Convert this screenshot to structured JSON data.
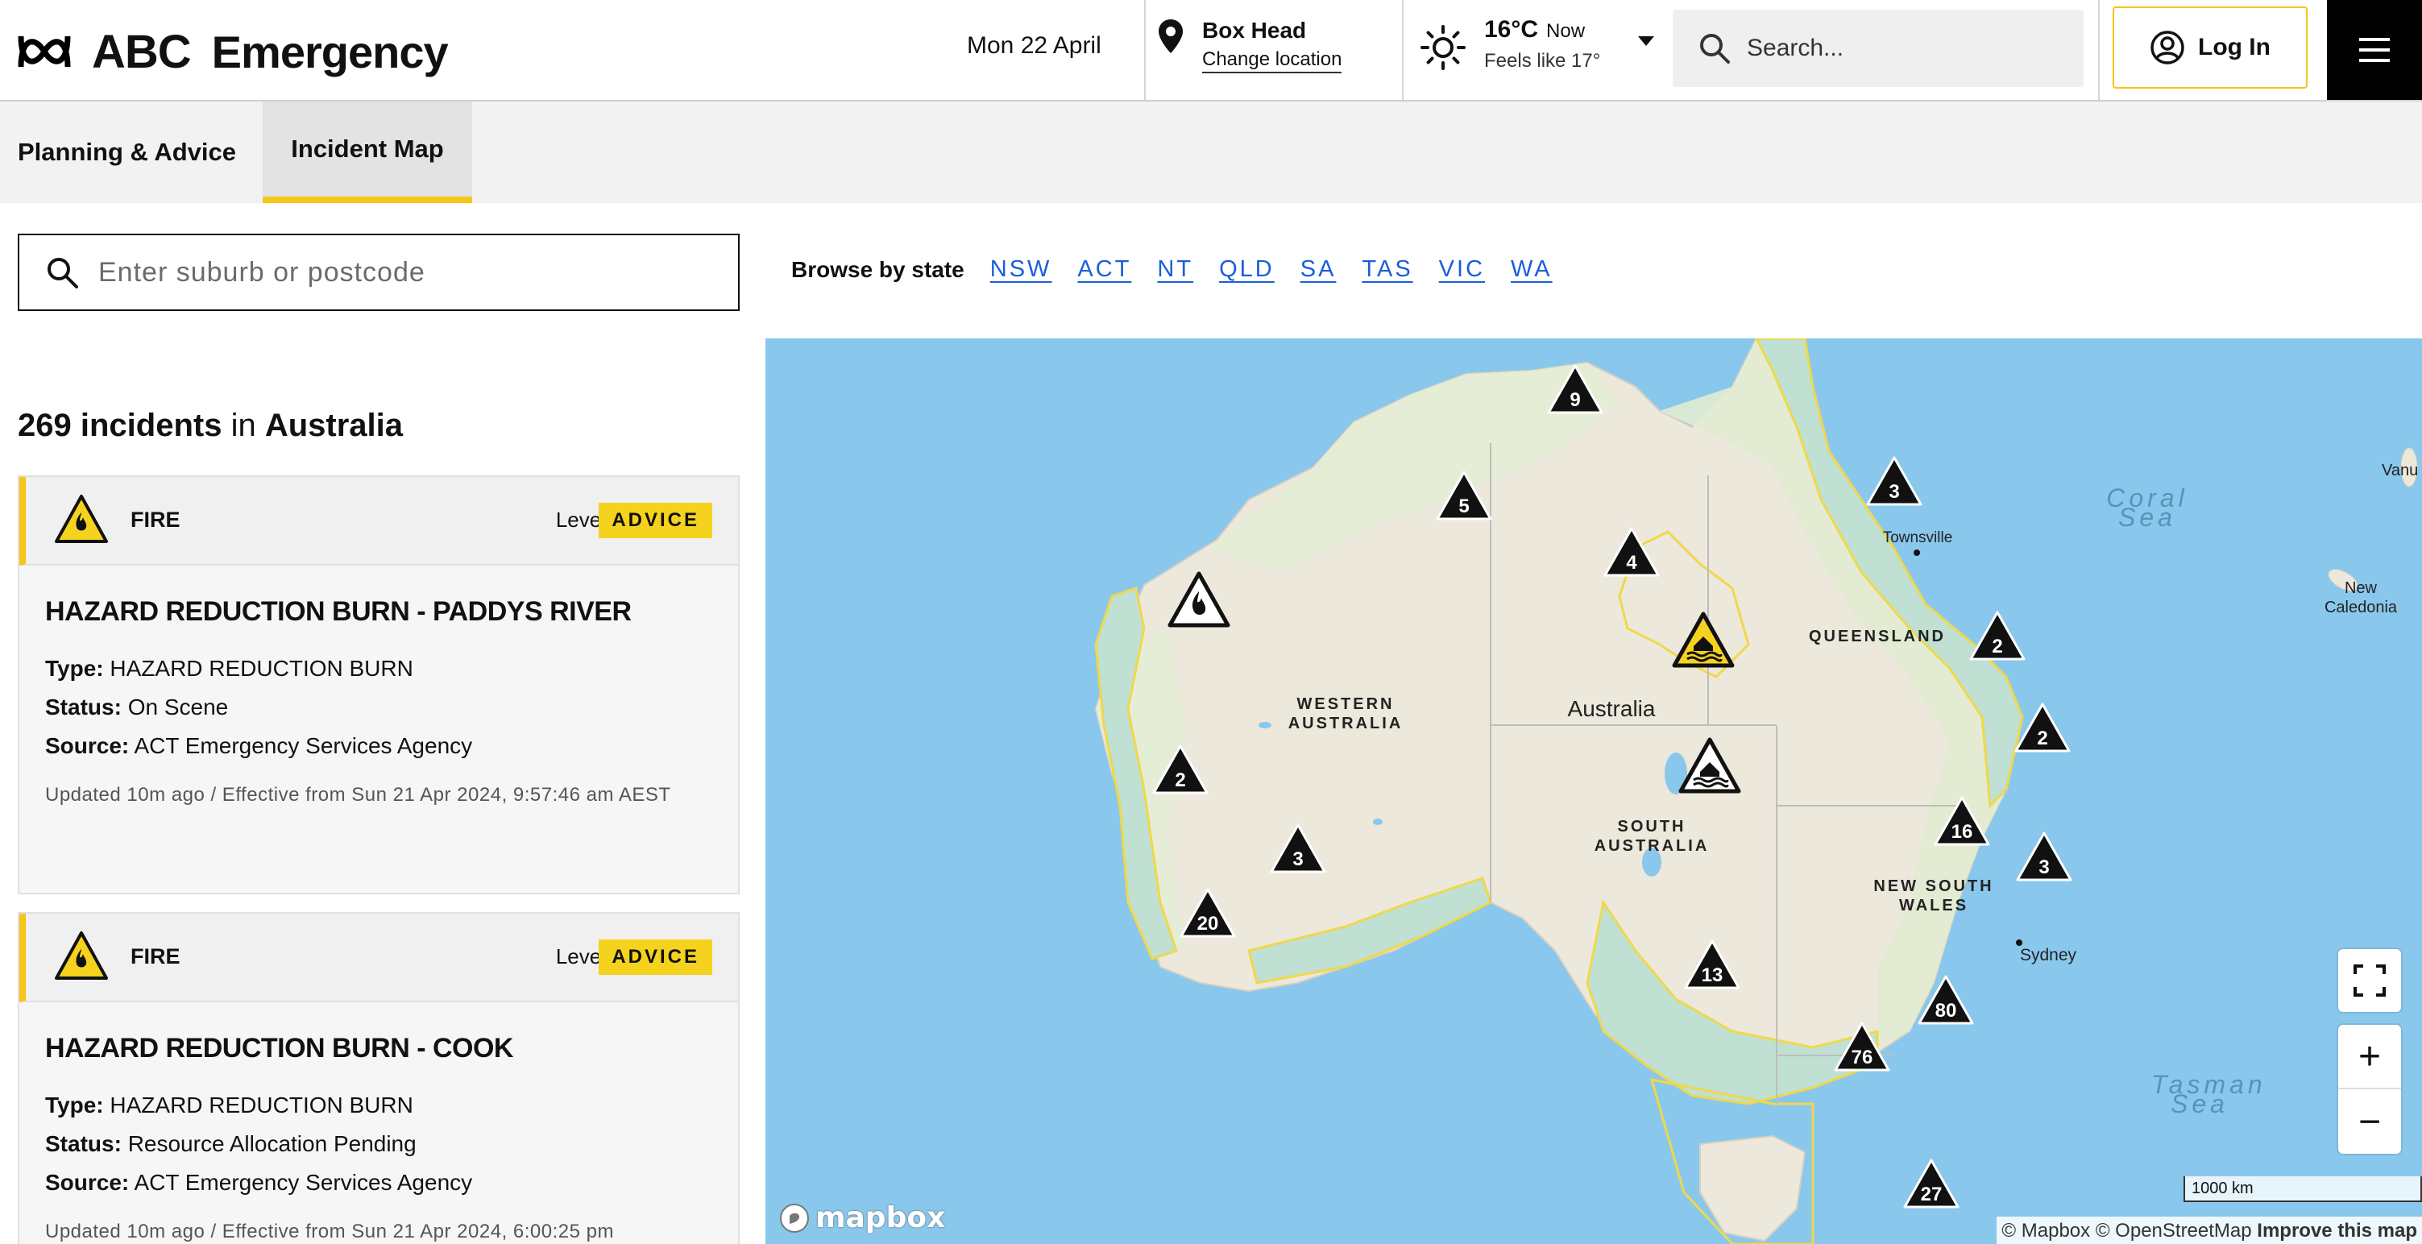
{
  "header": {
    "brand_abc": "ABC",
    "brand_section": "Emergency",
    "date": "Mon 22 April",
    "location_name": "Box Head",
    "location_change": "Change location",
    "temp": "16°C",
    "temp_when": "Now",
    "feels_like": "Feels like 17°",
    "search_placeholder": "Search...",
    "login_label": "Log In"
  },
  "nav": {
    "tabs": [
      {
        "label": "Planning & Advice"
      },
      {
        "label": "Incident Map"
      }
    ],
    "active_tab": "Incident Map"
  },
  "search": {
    "placeholder": "Enter suburb or postcode",
    "browse_label": "Browse by state",
    "states": [
      "NSW",
      "ACT",
      "NT",
      "QLD",
      "SA",
      "TAS",
      "VIC",
      "WA"
    ]
  },
  "list": {
    "count": "269 incidents",
    "in_text": "in",
    "region": "Australia",
    "incidents": [
      {
        "category": "FIRE",
        "level_label": "Level",
        "level": "ADVICE",
        "title": "HAZARD REDUCTION BURN - PADDYS RIVER",
        "type_label": "Type:",
        "type": "HAZARD REDUCTION BURN",
        "status_label": "Status:",
        "status": "On Scene",
        "source_label": "Source:",
        "source": "ACT Emergency Services Agency",
        "updated": "Updated 10m ago / Effective from Sun 21 Apr 2024, 9:57:46 am AEST"
      },
      {
        "category": "FIRE",
        "level_label": "Level",
        "level": "ADVICE",
        "title": "HAZARD REDUCTION BURN - COOK",
        "type_label": "Type:",
        "type": "HAZARD REDUCTION BURN",
        "status_label": "Status:",
        "status": "Resource Allocation Pending",
        "source_label": "Source:",
        "source": "ACT Emergency Services Agency",
        "updated": "Updated 10m ago / Effective from Sun 21 Apr 2024, 6:00:25 pm"
      }
    ]
  },
  "map": {
    "labels": {
      "australia": "Australia",
      "wa": "WESTERN AUSTRALIA",
      "sa": "SOUTH AUSTRALIA",
      "qld": "QUEENSLAND",
      "nsw": "NEW SOUTH WALES",
      "coral_sea": "Coral Sea",
      "tasman_sea": "Tasman Sea",
      "townsville": "Townsville",
      "sydney": "Sydney",
      "new_caledonia": "New Caledonia",
      "vanuatu": "Vanu"
    },
    "clusters": [
      "9",
      "5",
      "4",
      "3",
      "2",
      "2",
      "2",
      "3",
      "16",
      "3",
      "20",
      "13",
      "80",
      "76",
      "27"
    ],
    "controls": {
      "zoom_in": "+",
      "zoom_out": "−"
    },
    "scale": "1000 km",
    "attribution": "© Mapbox © OpenStreetMap",
    "improve": "Improve this map",
    "logo": "mapbox"
  },
  "colors": {
    "accent_yellow": "#f5c518",
    "link_blue": "#1a5fd8",
    "ocean": "#89c8ec",
    "land": "#ede8dc"
  }
}
